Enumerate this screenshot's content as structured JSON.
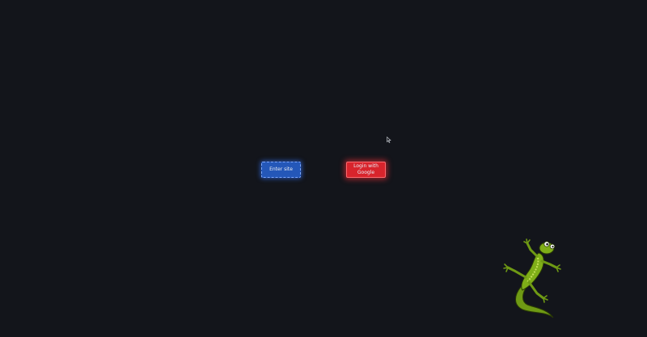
{
  "buttons": {
    "enter": {
      "label": "Enter site"
    },
    "google": {
      "label": "Login with Google"
    }
  },
  "colors": {
    "background": "#13151b",
    "enter_button": "#2457b8",
    "google_button": "#d8242c",
    "gecko": "#6f9a14"
  },
  "icons": {
    "cursor": "mouse-pointer-icon",
    "mascot": "gecko-icon"
  }
}
